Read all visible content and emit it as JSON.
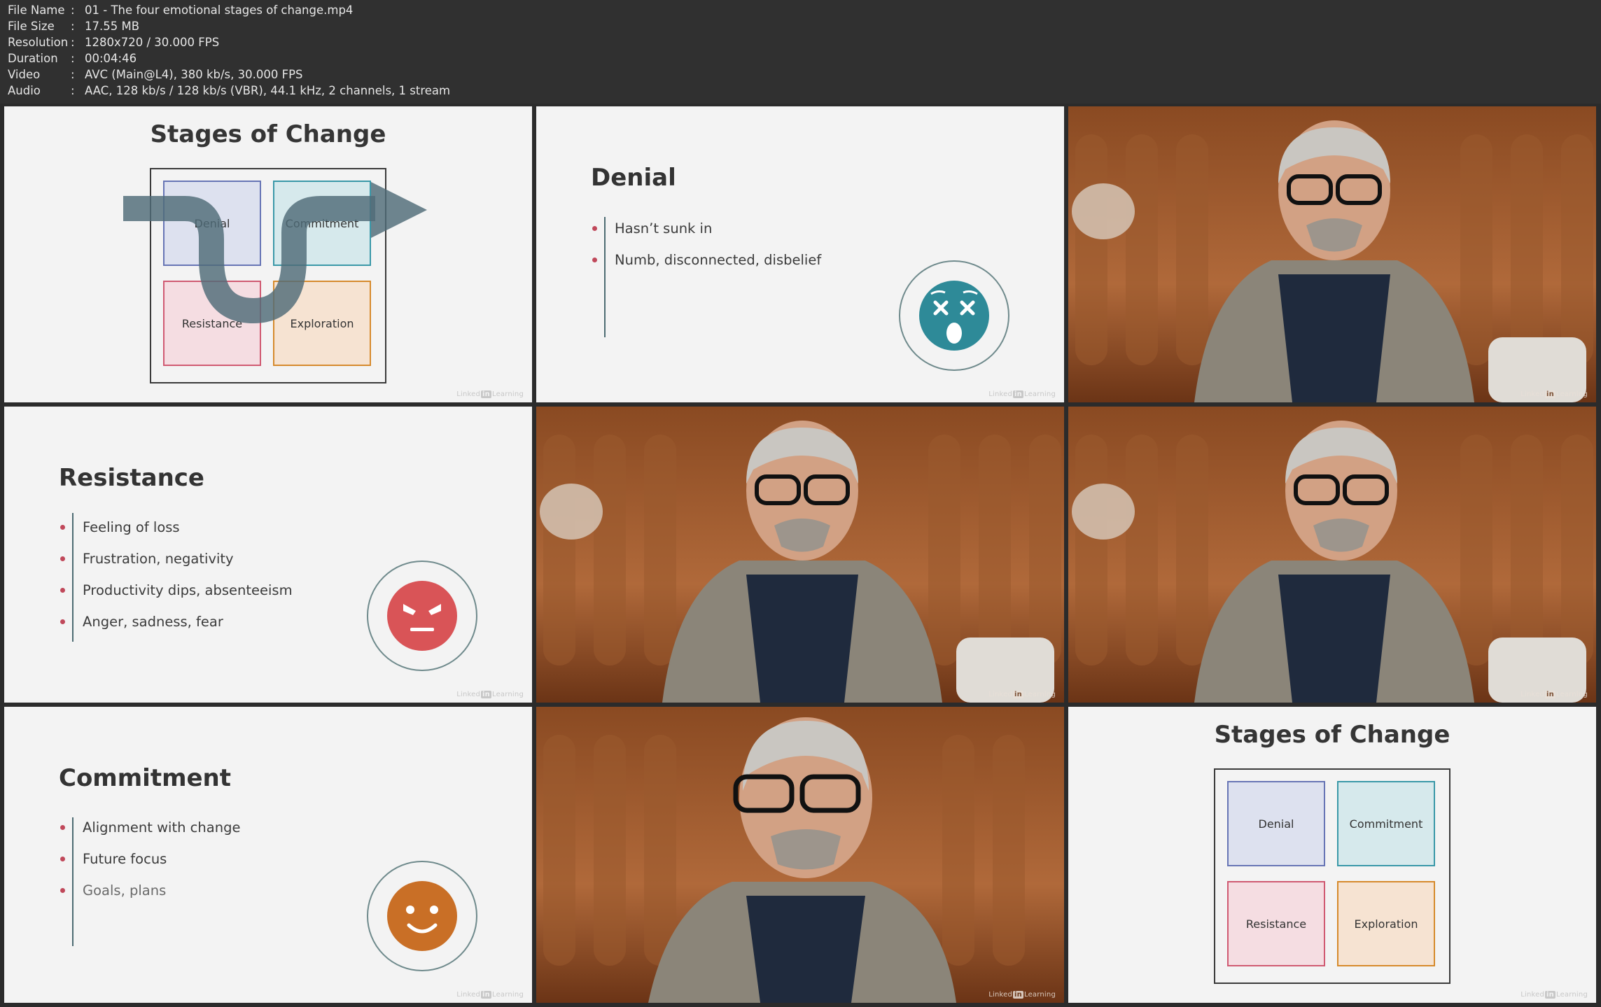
{
  "info": [
    {
      "key": "File Name",
      "value": "01 - The four emotional stages of change.mp4"
    },
    {
      "key": "File Size",
      "value": "17.55 MB"
    },
    {
      "key": "Resolution",
      "value": "1280x720 / 30.000 FPS"
    },
    {
      "key": "Duration",
      "value": "00:04:46"
    },
    {
      "key": "Video",
      "value": "AVC (Main@L4), 380 kb/s, 30.000 FPS"
    },
    {
      "key": "Audio",
      "value": "AAC, 128 kb/s / 128 kb/s (VBR), 44.1 kHz, 2 channels, 1 stream"
    }
  ],
  "separator": ":",
  "stages": {
    "title": "Stages of Change",
    "quadrants": {
      "denial": "Denial",
      "commitment": "Commitment",
      "resistance": "Resistance",
      "exploration": "Exploration"
    }
  },
  "denial_slide": {
    "title": "Denial",
    "bullets": [
      "Hasn’t sunk in",
      "Numb, disconnected, disbelief"
    ],
    "emoji": "shocked-face-icon",
    "emoji_color": "#2e8a98"
  },
  "resistance_slide": {
    "title": "Resistance",
    "bullets": [
      "Feeling of loss",
      "Frustration, negativity",
      "Productivity dips, absenteeism",
      "Anger, sadness, fear"
    ],
    "emoji": "angry-face-icon",
    "emoji_color": "#d95457"
  },
  "commitment_slide": {
    "title": "Commitment",
    "bullets": [
      "Alignment with change",
      "Future focus",
      "Goals, plans"
    ],
    "emoji": "smiling-face-icon",
    "emoji_color": "#c96f26"
  },
  "watermark": {
    "pre": "Linked",
    "in": "in",
    "post": "Learning"
  },
  "colors": {
    "background": "#2b2b2b",
    "slide_bg": "#f3f3f3",
    "bullet": "#c0485a",
    "video_bg": "#6b3416"
  }
}
